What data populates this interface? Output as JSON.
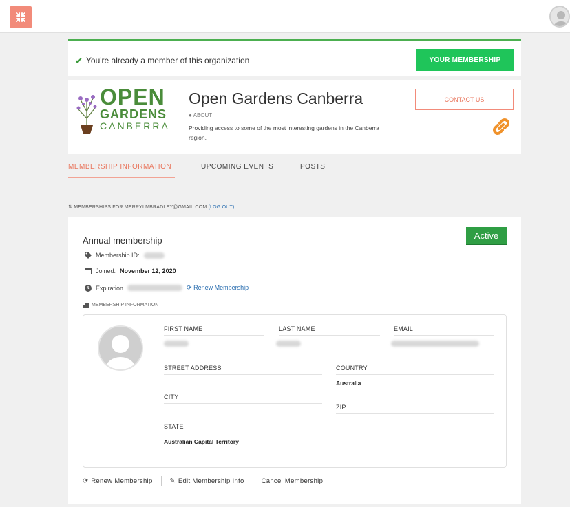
{
  "member_bar": {
    "message": "You're already a member of this organization",
    "button": "YOUR MEMBERSHIP"
  },
  "org": {
    "logo": {
      "line1": "OPEN",
      "line2": "GARDENS",
      "line3": "CANBERRA"
    },
    "name": "Open Gardens Canberra",
    "about_label": "ABOUT",
    "description": "Providing access to some of the most interesting gardens in the Canberra region.",
    "contact_button": "CONTACT US"
  },
  "tabs": [
    {
      "label": "MEMBERSHIP INFORMATION",
      "active": true
    },
    {
      "label": "UPCOMING EVENTS",
      "active": false
    },
    {
      "label": "POSTS",
      "active": false
    }
  ],
  "memberships_for": {
    "prefix": "MEMBERSHIPS FOR MERRYLMBRADLEY@GMAIL.COM",
    "logout": "(LOG OUT)"
  },
  "membership": {
    "title": "Annual membership",
    "status": "Active",
    "id_label": "Membership ID:",
    "joined_label": "Joined:",
    "joined_value": "November 12, 2020",
    "expiration_label": "Expiration",
    "renew_link": "Renew Membership",
    "info_section_label": "MEMBERSHIP INFORMATION"
  },
  "fields": {
    "first_name": "FIRST NAME",
    "last_name": "LAST NAME",
    "email": "EMAIL",
    "street_address": "STREET ADDRESS",
    "country": "COUNTRY",
    "country_value": "Australia",
    "city": "CITY",
    "zip": "ZIP",
    "state": "STATE",
    "state_value": "Australian Capital Territory"
  },
  "actions": {
    "renew": "Renew Membership",
    "edit": "Edit Membership Info",
    "cancel": "Cancel Membership"
  },
  "colors": {
    "accent": "#e9765d",
    "green": "#1fc55a",
    "active_badge": "#2f9e44",
    "link": "#2a6eb0"
  }
}
